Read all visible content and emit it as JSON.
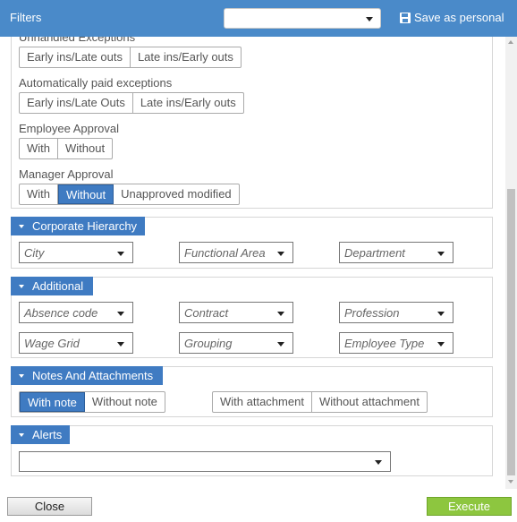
{
  "header": {
    "title": "Filters",
    "save_label": "Save as personal",
    "save_icon": "floppy-disk-icon"
  },
  "exceptions": {
    "unhandled_label": "Unhandled Exceptions",
    "unhandled_buttons": [
      "Early ins/Late outs",
      "Late ins/Early outs"
    ],
    "auto_paid_label": "Automatically paid exceptions",
    "auto_paid_buttons": [
      "Early ins/Late Outs",
      "Late ins/Early outs"
    ],
    "employee_approval_label": "Employee Approval",
    "employee_approval_buttons": [
      "With",
      "Without"
    ],
    "manager_approval_label": "Manager Approval",
    "manager_approval_buttons": [
      "With",
      "Without",
      "Unapproved modified"
    ],
    "manager_approval_selected": "Without"
  },
  "corporate_hierarchy": {
    "title": "Corporate Hierarchy",
    "fields": [
      "City",
      "Functional Area",
      "Department"
    ]
  },
  "additional": {
    "title": "Additional",
    "fields": [
      "Absence code",
      "Contract",
      "Profession",
      "Wage Grid",
      "Grouping",
      "Employee Type"
    ]
  },
  "notes": {
    "title": "Notes And Attachments",
    "note_buttons": [
      "With note",
      "Without note"
    ],
    "note_selected": "With note",
    "attachment_buttons": [
      "With attachment",
      "Without attachment"
    ]
  },
  "alerts": {
    "title": "Alerts",
    "value": ""
  },
  "footer": {
    "close_label": "Close",
    "execute_label": "Execute"
  },
  "colors": {
    "header_bg": "#4a8ac9",
    "accent": "#3f7bc2",
    "execute_bg": "#8dc63f"
  }
}
